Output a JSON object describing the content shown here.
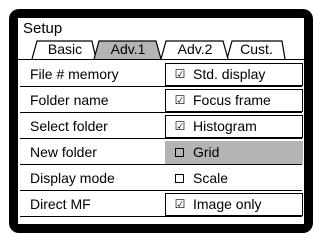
{
  "title": "Setup",
  "tabs": [
    {
      "label": "Basic",
      "active": false
    },
    {
      "label": "Adv.1",
      "active": true
    },
    {
      "label": "Adv.2",
      "active": false
    },
    {
      "label": "Cust.",
      "active": false
    }
  ],
  "menu": [
    {
      "label": "File # memory"
    },
    {
      "label": "Folder name"
    },
    {
      "label": "Select folder"
    },
    {
      "label": "New folder"
    },
    {
      "label": "Display mode"
    },
    {
      "label": "Direct MF"
    }
  ],
  "options": [
    {
      "label": "Std. display",
      "checked": true,
      "icon": "check-icon"
    },
    {
      "label": "Focus frame",
      "checked": true,
      "icon": "check-icon"
    },
    {
      "label": "Histogram",
      "checked": true,
      "icon": "check-icon"
    },
    {
      "label": "Grid",
      "checked": false,
      "selected": true,
      "icon": "box-icon"
    },
    {
      "label": "Scale",
      "checked": false,
      "icon": "box-icon"
    },
    {
      "label": "Image only",
      "checked": true,
      "icon": "check-icon"
    }
  ],
  "check_glyph": "☑",
  "colors": {
    "frame": "#000000",
    "screen": "#ffffff",
    "active_tab": "#b4b4b4",
    "selected_option": "#b4b4b4"
  }
}
